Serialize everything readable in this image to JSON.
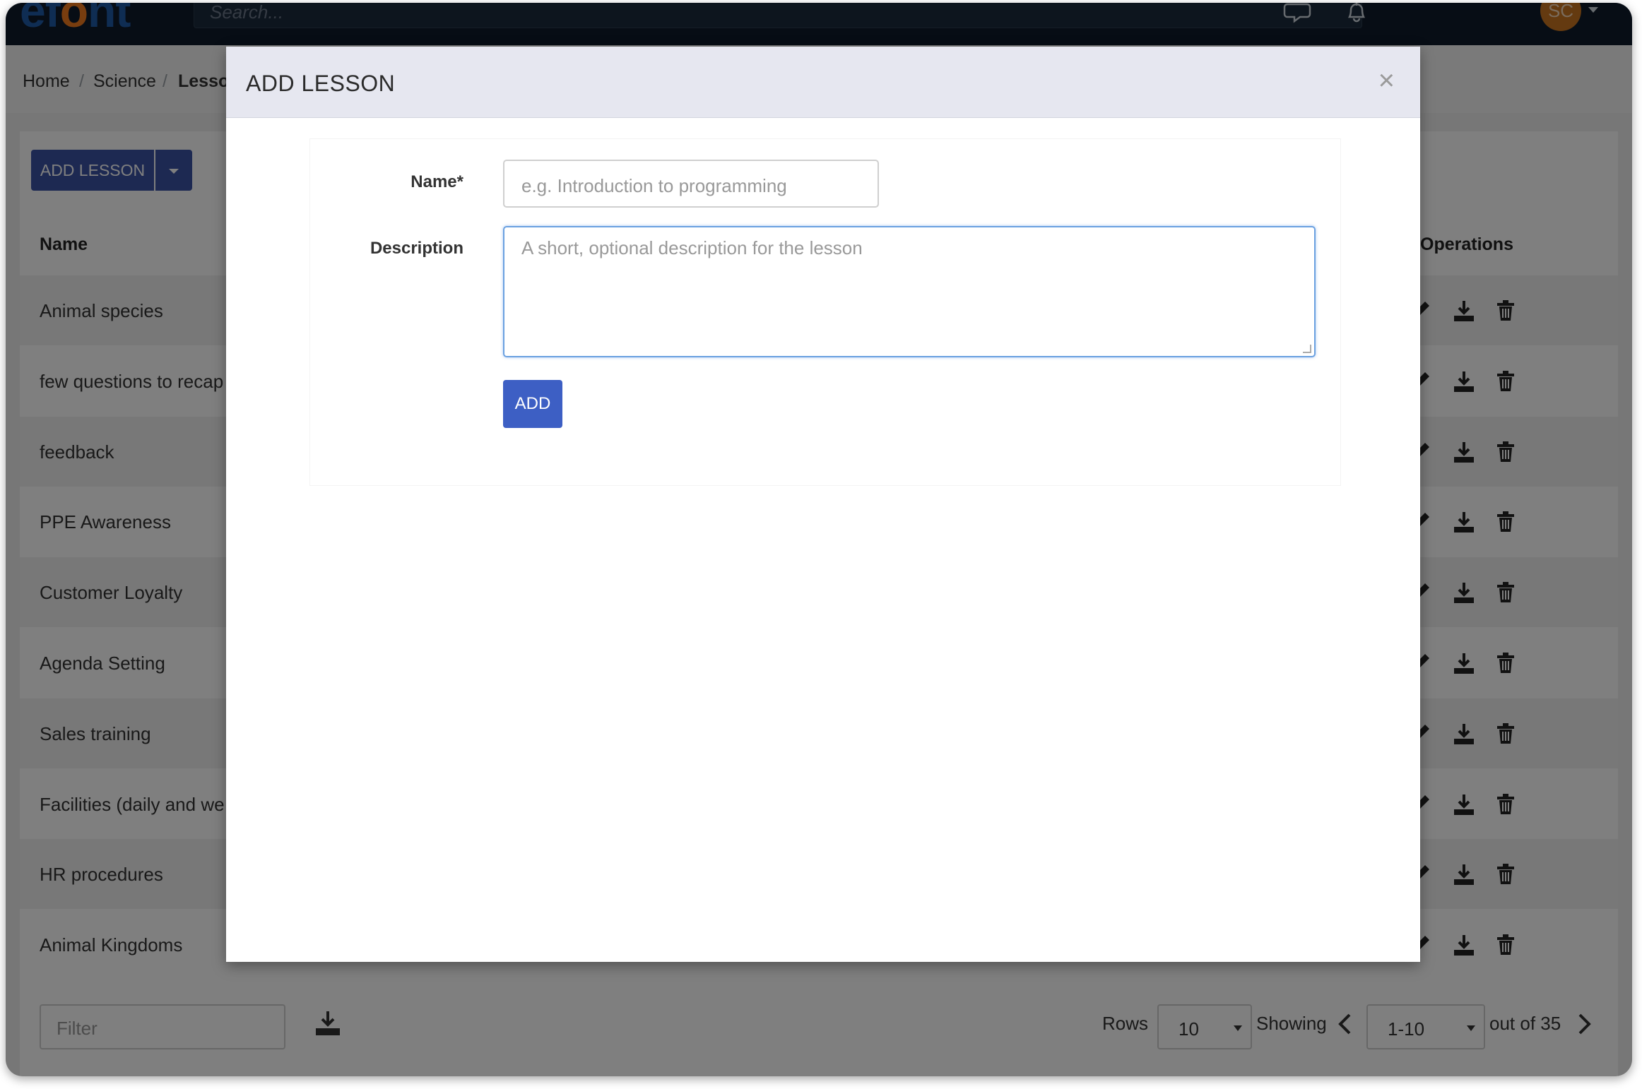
{
  "topbar": {
    "logo_prefix": "ef",
    "logo_accent": "o",
    "logo_suffix": "nt",
    "search_placeholder": "Search...",
    "avatar_initials": "SC"
  },
  "breadcrumb": [
    "Home",
    "Science",
    "Lesso"
  ],
  "toolbar": {
    "add_lesson_label": "ADD LESSON"
  },
  "table": {
    "headers": {
      "name": "Name",
      "operations": "Operations"
    },
    "rows": [
      "Animal species",
      "few questions to recap",
      "feedback",
      "PPE Awareness",
      "Customer Loyalty",
      "Agenda Setting",
      "Sales training",
      "Facilities (daily and we",
      "HR procedures",
      "Animal Kingdoms"
    ]
  },
  "footer": {
    "filter_placeholder": "Filter",
    "rows_label": "Rows",
    "rows_value": "10",
    "showing_label": "Showing",
    "range_value": "1-10",
    "out_of": "out of 35"
  },
  "modal": {
    "title": "ADD LESSON",
    "close_symbol": "×",
    "name_label": "Name*",
    "name_placeholder": "e.g. Introduction to programming",
    "description_label": "Description",
    "description_placeholder": "A short, optional description for the lesson",
    "submit_label": "ADD"
  },
  "colors": {
    "topbar_bg": "#0f1b2b",
    "logo_blue": "#1f5aa6",
    "logo_orange": "#f07a1f",
    "primary_button": "#3a53a5",
    "modal_header": "#e6e7f0",
    "focus_border": "#6aa0e0"
  }
}
